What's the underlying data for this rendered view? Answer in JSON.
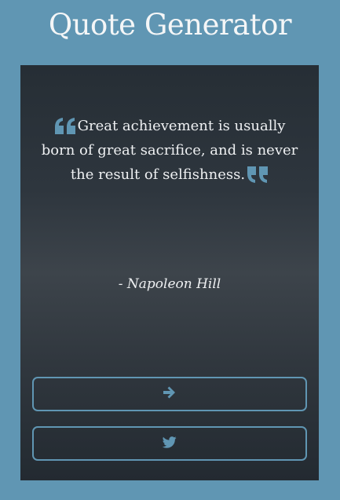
{
  "header": {
    "title": "Quote Generator"
  },
  "quote": {
    "text": "Great achievement is usually born of great sacrifice, and is never the result of selfishness.",
    "author": "- Napoleon Hill"
  },
  "buttons": {
    "next_icon": "arrow-right-icon",
    "tweet_icon": "twitter-icon"
  },
  "colors": {
    "background": "#6096b3",
    "accent": "#6096b3",
    "card": "#2e363e",
    "text": "#eef0f2"
  }
}
